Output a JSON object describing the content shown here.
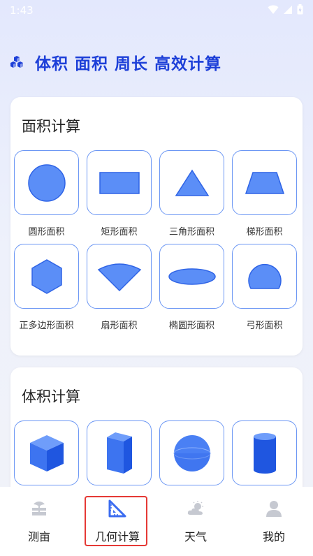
{
  "status_bar": {
    "time": "1:43"
  },
  "header": {
    "title": "体积 面积 周长 高效计算"
  },
  "area_card": {
    "title": "面积计算",
    "items": [
      {
        "label": "圆形面积",
        "icon": "circle-icon"
      },
      {
        "label": "矩形面积",
        "icon": "rectangle-icon"
      },
      {
        "label": "三角形面积",
        "icon": "triangle-icon"
      },
      {
        "label": "梯形面积",
        "icon": "trapezoid-icon"
      },
      {
        "label": "正多边形面积",
        "icon": "hexagon-icon"
      },
      {
        "label": "扇形面积",
        "icon": "sector-icon"
      },
      {
        "label": "椭圆形面积",
        "icon": "ellipse-icon"
      },
      {
        "label": "弓形面积",
        "icon": "segment-icon"
      }
    ]
  },
  "volume_card": {
    "title": "体积计算",
    "items": [
      {
        "icon": "cube-icon"
      },
      {
        "icon": "prism-icon"
      },
      {
        "icon": "sphere-icon"
      },
      {
        "icon": "cylinder-icon"
      }
    ]
  },
  "bottom_nav": {
    "items": [
      {
        "label": "测亩",
        "icon": "field-icon",
        "active": false
      },
      {
        "label": "几何计算",
        "icon": "ruler-triangle-icon",
        "active": true
      },
      {
        "label": "天气",
        "icon": "weather-icon",
        "active": false
      },
      {
        "label": "我的",
        "icon": "user-icon",
        "active": false
      }
    ]
  },
  "colors": {
    "accent": "#1d3fd8",
    "shape_fill": "#5b8ef7",
    "shape_stroke": "#2f64e6",
    "tile_border": "#6c97f4",
    "nav_active": "#3b6cf0",
    "nav_inactive": "#c6c9d1",
    "highlight_frame": "#e53935"
  }
}
